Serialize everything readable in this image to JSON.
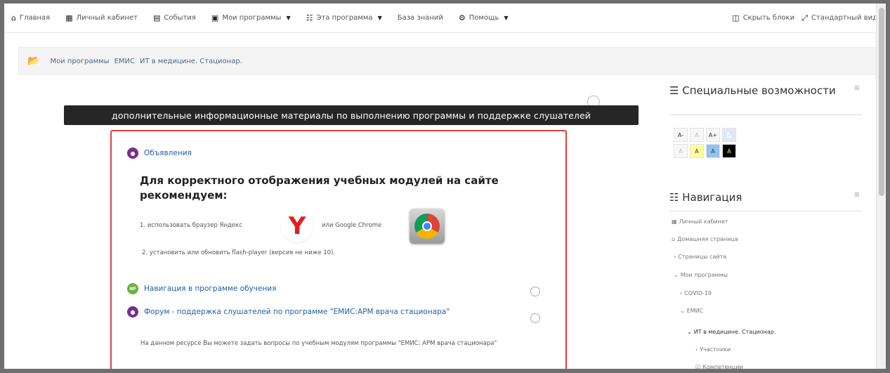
{
  "navbar": {
    "home": "Главная",
    "cabinet": "Личный кабинет",
    "events": "События",
    "my_programs": "Мои программы",
    "this_program": "Эта программа",
    "knowledge_base": "База знаний",
    "help": "Помощь",
    "hide_blocks": "Скрыть блоки",
    "standard_view": "Стандартный вид"
  },
  "breadcrumb": {
    "items": [
      "Мои программы",
      "ЕМИС",
      "ИТ в медицине. Стационар."
    ]
  },
  "tooltip": "дополнительные информационные материалы по выполнению программы и поддержке слушателей",
  "content": {
    "announcements": "Объявления",
    "headline": "Для корректного отображения учебных модулей на сайте рекомендуем:",
    "line1_prefix": "1. использовать браузер Яндекс",
    "line1_or": "или Google Chrome",
    "line2": "2. установить или обновить flash-player (версия не ниже 10).",
    "nav_program": "Навигация в программе обучения",
    "forum": "Форум - поддержка слушателей по программе \"ЕМИС:АРМ врача стационара\"",
    "description": "На данном ресурсе Вы можете задать вопросы по учебным модулям программы \"ЕМИС: АРМ врача стационара\""
  },
  "accessibility": {
    "title": "Специальные возможности",
    "buttons": [
      "A-",
      "A",
      "A+",
      "",
      "A",
      "A",
      "A",
      "A"
    ]
  },
  "navigation": {
    "title": "Навигация",
    "items": [
      "Личный кабинет",
      "Домашняя страница",
      "Страницы сайта",
      "Мои программы",
      "COVID-19",
      "ЕМИС",
      "ИТ в медицине. Стационар.",
      "Участники",
      "Компетенции"
    ]
  },
  "colors": {
    "announcement_icon": "#7b2d8e",
    "nav_icon": "#6cb33f",
    "box_border": "#e04040",
    "tooltip_bg": "#262626"
  }
}
